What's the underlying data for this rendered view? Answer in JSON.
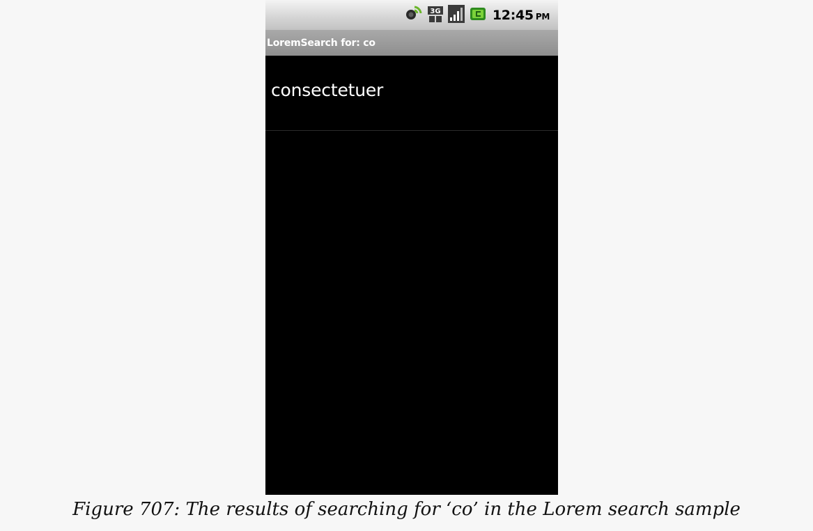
{
  "status_bar": {
    "icons": [
      "sync-icon",
      "network-3g-icon",
      "signal-icon",
      "battery-charging-icon"
    ],
    "time": "12:45",
    "ampm": "PM"
  },
  "title_bar": {
    "title": "LoremSearch for: co"
  },
  "results": [
    {
      "label": "consectetuer"
    }
  ],
  "caption": "Figure 707: The results of searching for ‘co’ in the Lorem search sample"
}
